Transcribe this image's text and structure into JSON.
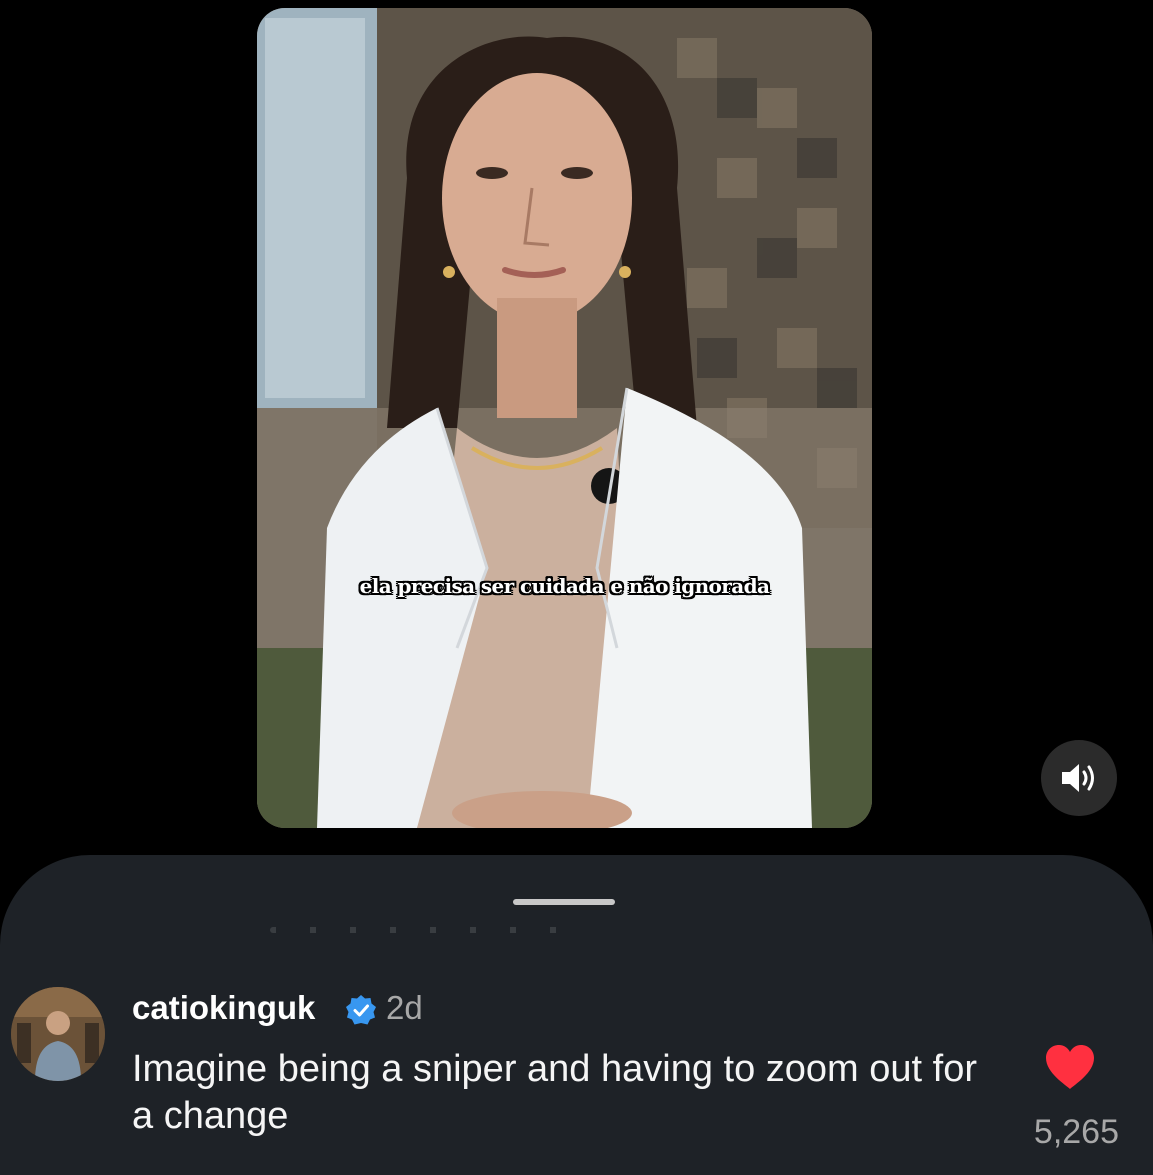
{
  "video": {
    "caption": "ela precisa ser cuidada e não ignorada"
  },
  "controls": {
    "sound_icon": "speaker-volume-icon"
  },
  "comment": {
    "username": "catiokinguk",
    "verified": true,
    "time": "2d",
    "text": "Imagine being a sniper and having to zoom out for a change",
    "likes": "5,265",
    "liked": true,
    "like_color": "#ff3040",
    "verified_color": "#3897f0"
  }
}
